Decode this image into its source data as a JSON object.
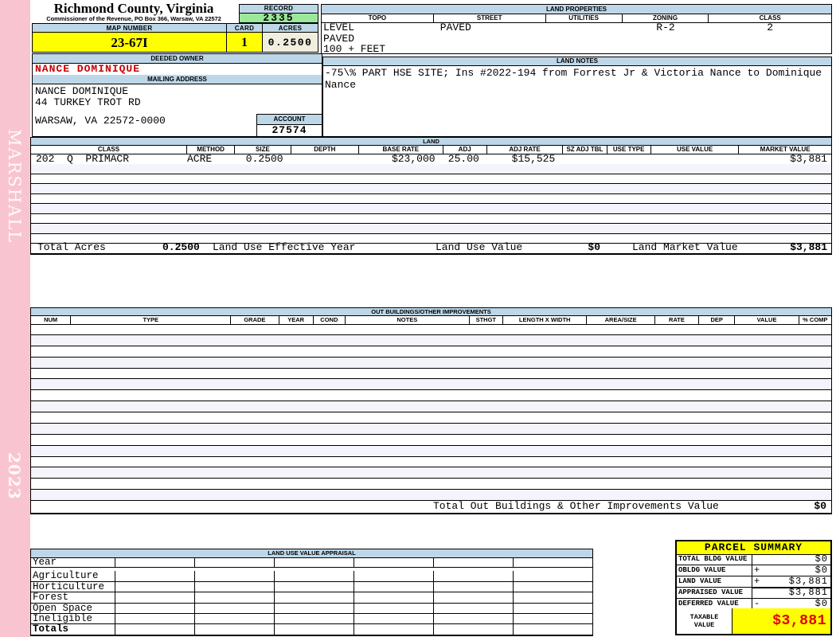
{
  "sidebar": {
    "clerk": "MARSHALL",
    "year": "2023"
  },
  "header": {
    "county_title": "Richmond County, Virginia",
    "commissioner_line": "Commissioner of the Revenue, PO Box 366, Warsaw, VA 22572",
    "record_label": "RECORD",
    "record_value": "2335",
    "map_number_label": "MAP NUMBER",
    "map_number_value": "23-67I",
    "card_label": "CARD",
    "card_value": "1",
    "acres_label": "ACRES",
    "acres_value": "0.2500"
  },
  "land_properties": {
    "title": "LAND PROPERTIES",
    "columns": [
      "TOPO",
      "STREET",
      "UTILITIES",
      "ZONING",
      "CLASS"
    ],
    "topo_lines": "LEVEL\nPAVED\n100 + FEET",
    "street": "PAVED",
    "utilities": "",
    "zoning": "R-2",
    "class": "2"
  },
  "owner": {
    "deeded_owner_label": "DEEDED OWNER",
    "deeded_owner": "NANCE DOMINIQUE",
    "mailing_address_label": "MAILING ADDRESS",
    "address_lines_1_2": "NANCE DOMINIQUE\n44 TURKEY TROT RD",
    "address_line_4": "WARSAW, VA 22572-0000",
    "account_label": "ACCOUNT",
    "account_value": "27574"
  },
  "land_notes": {
    "title": "LAND NOTES",
    "text": "-75\\% PART HSE SITE; Ins #2022-194 from Forrest Jr & Victoria Nance to Dominique Nance"
  },
  "land": {
    "title": "LAND",
    "columns": [
      "CLASS",
      "METHOD",
      "SIZE",
      "DEPTH",
      "BASE RATE",
      "ADJ",
      "ADJ RATE",
      "SZ ADJ TBL",
      "USE TYPE",
      "USE VALUE",
      "MARKET VALUE"
    ],
    "rows": [
      [
        "202  Q  PRIMACR",
        "ACRE",
        "0.2500",
        "",
        "$23,000",
        "25.00",
        "$15,525",
        "",
        "",
        "",
        "$3,881"
      ]
    ],
    "empty_row_count": 8,
    "totals": {
      "total_acres_label": "Total Acres",
      "total_acres": "0.2500",
      "effective_year_label": "Land Use Effective Year",
      "effective_year": "",
      "land_use_value_label": "Land Use Value",
      "land_use_value": "$0",
      "land_market_value_label": "Land Market Value",
      "land_market_value": "$3,881"
    }
  },
  "out_buildings": {
    "title": "OUT BUILDINGS/OTHER IMPROVEMENTS",
    "columns": [
      "NUM",
      "TYPE",
      "GRADE",
      "YEAR",
      "COND",
      "NOTES",
      "STHGT",
      "LENGTH X WIDTH",
      "AREA/SIZE",
      "RATE",
      "DEP",
      "VALUE",
      "% COMP"
    ],
    "empty_row_count": 16,
    "total_label": "Total Out Buildings & Other Improvements Value",
    "total_value": "$0"
  },
  "land_use_appraisal": {
    "title": "LAND USE VALUE APPRAISAL",
    "row_labels": [
      "Year",
      "Agriculture",
      "Horticulture",
      "Forest",
      "Open Space",
      "Ineligible",
      "Totals"
    ],
    "data_column_count": 6
  },
  "parcel_summary": {
    "title": "PARCEL SUMMARY",
    "rows": [
      {
        "label": "TOTAL BLDG VALUE",
        "op": "",
        "value": "$0"
      },
      {
        "label": "OBLDG VALUE",
        "op": "+",
        "value": "$0"
      },
      {
        "label": "LAND VALUE",
        "op": "+",
        "value": "$3,881"
      },
      {
        "label": "APPRAISED VALUE",
        "op": "",
        "value": "$3,881"
      },
      {
        "label": "DEFERRED VALUE",
        "op": "-",
        "value": "$0"
      }
    ],
    "taxable_label": "TAXABLE\nVALUE",
    "taxable_value": "$3,881"
  },
  "colors": {
    "header_bar_blue": "#BDD7E8",
    "record_green": "#9BE89B",
    "highlight_yellow": "#FFFF00",
    "acres_beige": "#EFEEDF",
    "owner_red": "#C80000",
    "taxable_red": "#E00000",
    "row_stripe": "#F4F4FD",
    "spine_pink": "#F8C4D0"
  }
}
